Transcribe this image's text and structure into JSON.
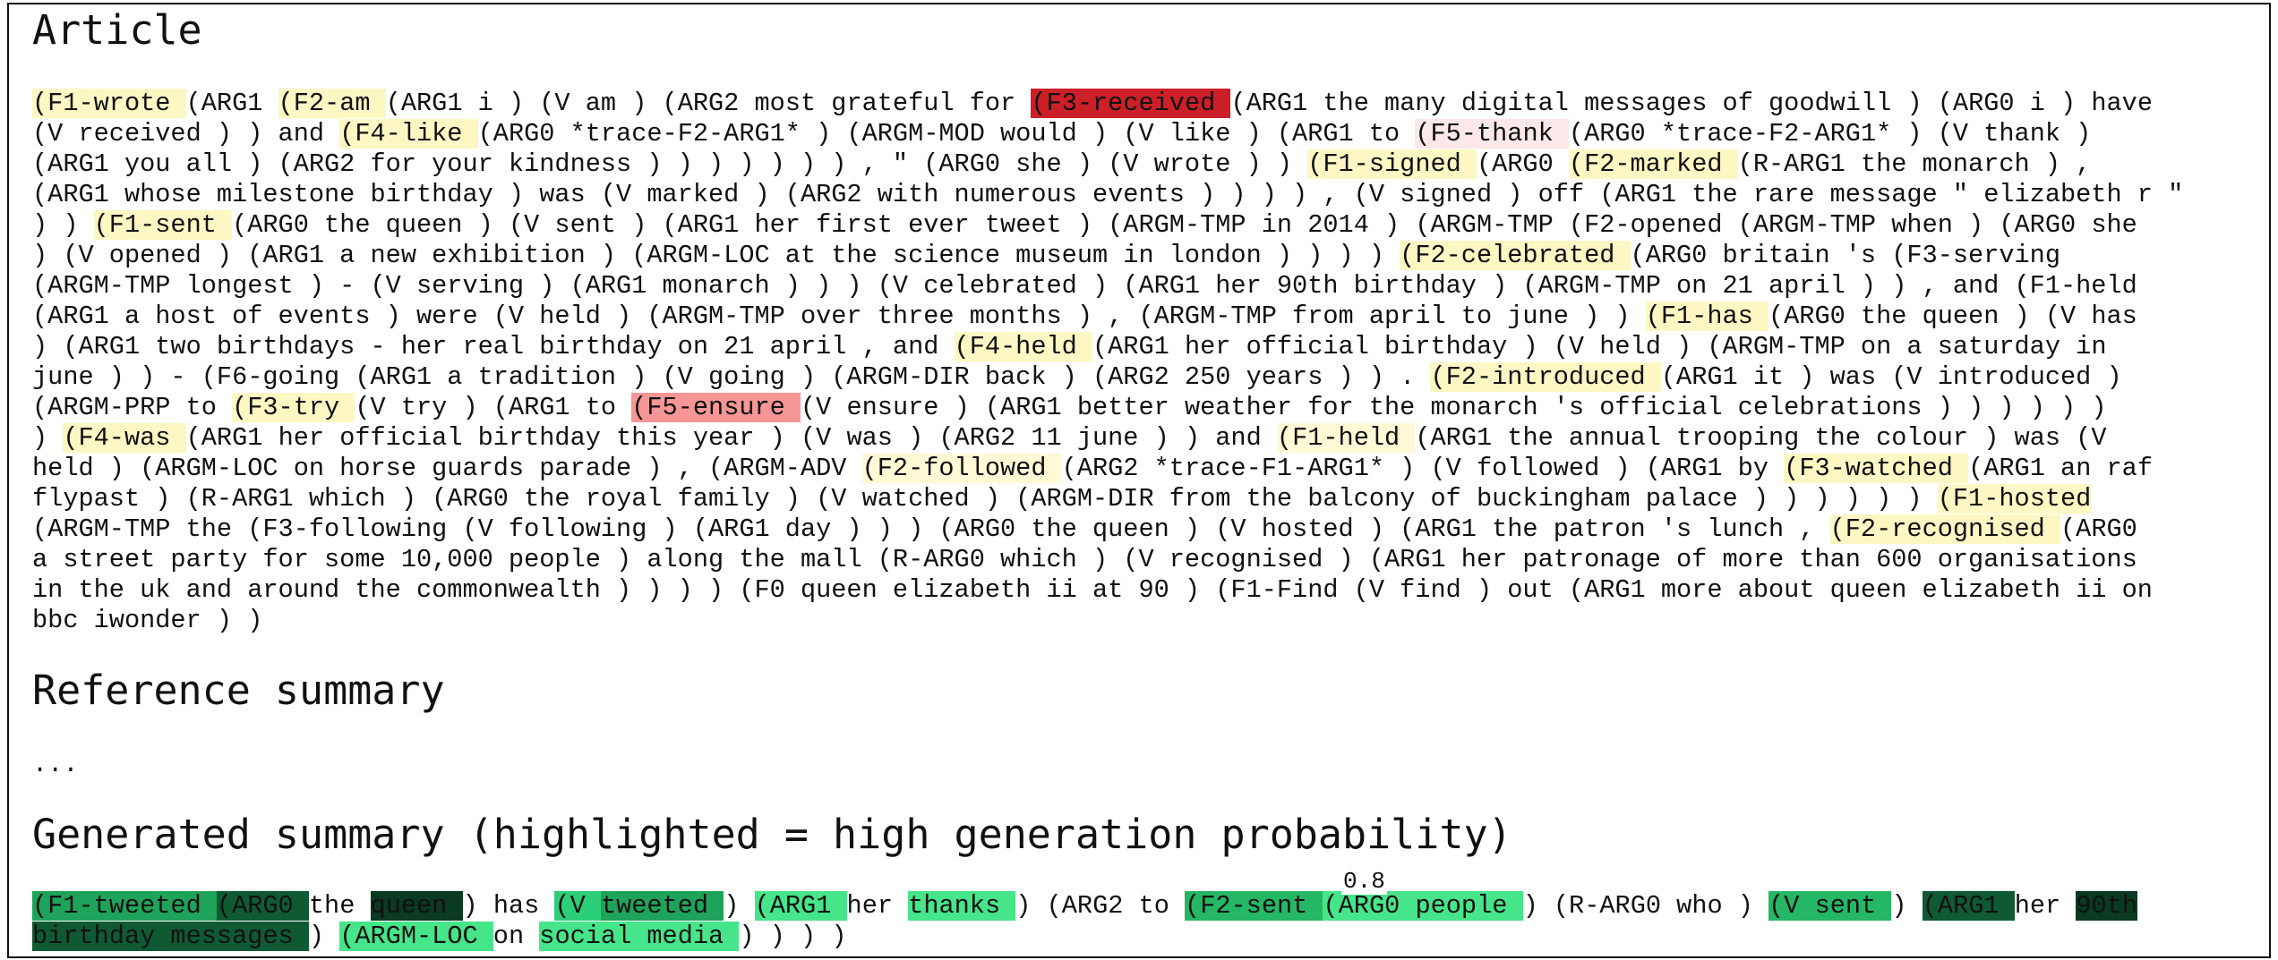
{
  "headings": {
    "article": "Article",
    "reference": "Reference summary",
    "generated": "Generated summary (highlighted = high generation probability)"
  },
  "reference_text": "...",
  "prob_label": "0.8",
  "article_lines": [
    [
      {
        "t": "(F1-wrote ",
        "c": "y"
      },
      {
        "t": "(ARG1 "
      },
      {
        "t": "(F2-am ",
        "c": "y"
      },
      {
        "t": "(ARG1 i ) (V am ) (ARG2 most grateful for "
      },
      {
        "t": "(F3-received ",
        "c": "red"
      },
      {
        "t": "(ARG1 the many digital messages of goodwill ) (ARG0 i ) have"
      }
    ],
    [
      {
        "t": "(V received ) ) and "
      },
      {
        "t": "(F4-like ",
        "c": "y"
      },
      {
        "t": "(ARG0 *trace-F2-ARG1* ) (ARGM-MOD would ) (V like ) (ARG1 to "
      },
      {
        "t": "(F5-thank ",
        "c": "pk"
      },
      {
        "t": "(ARG0 *trace-F2-ARG1* ) (V thank )"
      }
    ],
    [
      {
        "t": "(ARG1 you all ) (ARG2 for your kindness ) ) ) ) ) ) ) , \" (ARG0 she ) (V wrote ) ) "
      },
      {
        "t": "(F1-signed ",
        "c": "y"
      },
      {
        "t": "(ARG0 "
      },
      {
        "t": "(F2-marked ",
        "c": "y"
      },
      {
        "t": "(R-ARG1 the monarch ) ,"
      }
    ],
    [
      {
        "t": "(ARG1 whose milestone birthday ) was (V marked ) (ARG2 with numerous events ) ) ) ) , (V signed ) off (ARG1 the rare message \" elizabeth r \""
      }
    ],
    [
      {
        "t": ") ) "
      },
      {
        "t": "(F1-sent ",
        "c": "y"
      },
      {
        "t": "(ARG0 the queen ) (V sent ) (ARG1 her first ever tweet ) (ARGM-TMP in 2014 ) (ARGM-TMP (F2-opened (ARGM-TMP when ) (ARG0 she"
      }
    ],
    [
      {
        "t": ") (V opened ) (ARG1 a new exhibition ) (ARGM-LOC at the science museum in london ) ) ) ) "
      },
      {
        "t": "(F2-celebrated ",
        "c": "y"
      },
      {
        "t": "(ARG0 britain 's (F3-serving"
      }
    ],
    [
      {
        "t": "(ARGM-TMP longest ) - (V serving ) (ARG1 monarch ) ) ) (V celebrated ) (ARG1 her 90th birthday ) (ARGM-TMP on 21 april ) ) , and (F1-held"
      }
    ],
    [
      {
        "t": "(ARG1 a host of events ) were (V held ) (ARGM-TMP over three months ) , (ARGM-TMP from april to june ) ) "
      },
      {
        "t": "(F1-has ",
        "c": "y"
      },
      {
        "t": "(ARG0 the queen ) (V has"
      }
    ],
    [
      {
        "t": ") (ARG1 two birthdays - her real birthday on 21 april , and "
      },
      {
        "t": "(F4-held ",
        "c": "y"
      },
      {
        "t": "(ARG1 her official birthday ) (V held ) (ARGM-TMP on a saturday in"
      }
    ],
    [
      {
        "t": "june ) ) - (F6-going (ARG1 a tradition ) (V going ) (ARGM-DIR back ) (ARG2 250 years ) ) . "
      },
      {
        "t": "(F2-introduced ",
        "c": "y"
      },
      {
        "t": "(ARG1 it ) was (V introduced )"
      }
    ],
    [
      {
        "t": "(ARGM-PRP to "
      },
      {
        "t": "(F3-try ",
        "c": "y"
      },
      {
        "t": "(V try ) (ARG1 to "
      },
      {
        "t": "(F5-ensure ",
        "c": "salmon"
      },
      {
        "t": "(V ensure ) (ARG1 better weather for the monarch 's official celebrations ) ) ) ) ) )"
      }
    ],
    [
      {
        "t": ") "
      },
      {
        "t": "(F4-was ",
        "c": "y"
      },
      {
        "t": "(ARG1 her official birthday this year ) (V was ) (ARG2 11 june ) ) and "
      },
      {
        "t": "(F1-held ",
        "c": "y2"
      },
      {
        "t": "(ARG1 the annual trooping the colour ) was (V"
      }
    ],
    [
      {
        "t": "held ) (ARGM-LOC on horse guards parade ) , (ARGM-ADV "
      },
      {
        "t": "(F2-followed ",
        "c": "y2"
      },
      {
        "t": "(ARG2 *trace-F1-ARG1* ) (V followed ) (ARG1 by "
      },
      {
        "t": "(F3-watched ",
        "c": "y"
      },
      {
        "t": "(ARG1 an raf"
      }
    ],
    [
      {
        "t": "flypast ) (R-ARG1 which ) (ARG0 the royal family ) (V watched ) (ARGM-DIR from the balcony of buckingham palace ) ) ) ) ) ) "
      },
      {
        "t": "(F1-hosted",
        "c": "y"
      }
    ],
    [
      {
        "t": "(ARGM-TMP the (F3-following (V following ) (ARG1 day ) ) ) (ARG0 the queen ) (V hosted ) (ARG1 the patron 's lunch , "
      },
      {
        "t": "(F2-recognised ",
        "c": "y"
      },
      {
        "t": "(ARG0"
      }
    ],
    [
      {
        "t": "a street party for some 10,000 people ) along the mall (R-ARG0 which ) (V recognised ) (ARG1 her patronage of more than 600 organisations"
      }
    ],
    [
      {
        "t": "in the uk and around the commonwealth ) ) ) ) (F0 queen elizabeth ii at 90 ) (F1-Find (V find ) out (ARG1 more about queen elizabeth ii on"
      }
    ],
    [
      {
        "t": "bbc iwonder ) )"
      }
    ]
  ],
  "generated_lines": [
    [
      {
        "t": "(F1-tweeted ",
        "c": "g1"
      },
      {
        "t": "(ARG0 ",
        "c": "dg"
      },
      {
        "t": "the "
      },
      {
        "t": "queen ",
        "c": "vdg"
      },
      {
        "t": ") has "
      },
      {
        "t": "(V ",
        "c": "g2"
      },
      {
        "t": "tweeted ",
        "c": "g1"
      },
      {
        "t": ") "
      },
      {
        "t": "(ARG1 ",
        "c": "g3"
      },
      {
        "t": "her "
      },
      {
        "t": "thanks ",
        "c": "g3"
      },
      {
        "t": ") (ARG2 to "
      },
      {
        "t": "(F2-sent ",
        "c": "g4"
      },
      {
        "t": "(ARG0 ",
        "c": "g3"
      },
      {
        "t": "people ",
        "c": "g3"
      },
      {
        "t": ") (R-ARG0 who ) "
      },
      {
        "t": "(V sent ",
        "c": "g4"
      },
      {
        "t": ") "
      },
      {
        "t": "(ARG1 ",
        "c": "dg"
      },
      {
        "t": "her "
      },
      {
        "t": "90th",
        "c": "vdg"
      }
    ],
    [
      {
        "t": "birthday messages ",
        "c": "dg"
      },
      {
        "t": ") "
      },
      {
        "t": "(ARGM-LOC ",
        "c": "g3"
      },
      {
        "t": "on "
      },
      {
        "t": "social media ",
        "c": "g3"
      },
      {
        "t": ") ) ) )"
      }
    ]
  ],
  "colors": {
    "yellow": "#fdf7c4",
    "red": "#cc1f27",
    "salmon": "#f79696",
    "pink": "#fce8e8",
    "green_mid": "#1fa35a",
    "green_light": "#46e58a",
    "green_dark": "#0f5a33",
    "green_darkest": "#0a3a22"
  }
}
